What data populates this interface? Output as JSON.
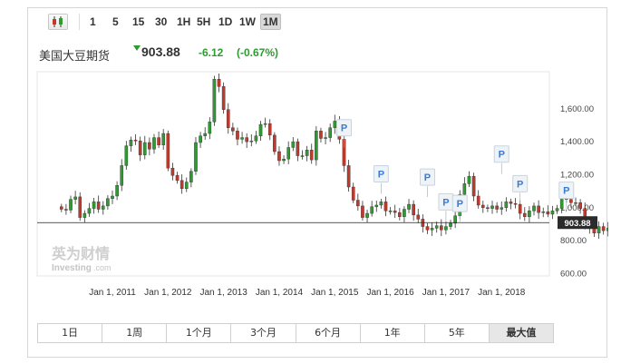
{
  "toolbar": {
    "chart_type_icon": "candlestick-icon",
    "timeframes": [
      "1",
      "5",
      "15",
      "30",
      "1H",
      "5H",
      "1D",
      "1W",
      "1M"
    ],
    "active_timeframe": "1M"
  },
  "header": {
    "instrument": "美国大豆期货",
    "direction_icon": "triangle-down-icon",
    "price": "903.88",
    "change": "-6.12",
    "change_pct": "(-0.67%)",
    "change_color": "#2f9a31"
  },
  "watermark": {
    "logo_text": "英为财情",
    "brand": "Investing",
    "domain": ".com"
  },
  "chart_data": {
    "type": "candlestick",
    "y_ticks": [
      "1,600.00",
      "1,400.00",
      "1,200.00",
      "1,000.00",
      "800.00",
      "600.00"
    ],
    "x_ticks": [
      "Jan 1, 2011",
      "Jan 1, 2012",
      "Jan 1, 2013",
      "Jan 1, 2014",
      "Jan 1, 2015",
      "Jan 1, 2016",
      "Jan 1, 2017",
      "Jan 1, 2018"
    ],
    "ylim": [
      580,
      1820
    ],
    "current_price_label": "903.88",
    "current_price": 903.88,
    "up_color": "#2f9a31",
    "down_color": "#c0392b",
    "monthly_close": [
      985,
      980,
      1045,
      1060,
      935,
      960,
      990,
      1030,
      985,
      1005,
      1050,
      1065,
      1130,
      1250,
      1370,
      1405,
      1400,
      1315,
      1390,
      1350,
      1420,
      1375,
      1445,
      1235,
      1190,
      1160,
      1110,
      1150,
      1215,
      1390,
      1430,
      1445,
      1515,
      1775,
      1730,
      1590,
      1480,
      1460,
      1410,
      1420,
      1395,
      1400,
      1430,
      1500,
      1505,
      1435,
      1335,
      1280,
      1290,
      1360,
      1395,
      1310,
      1310,
      1345,
      1285,
      1460,
      1415,
      1420,
      1480,
      1520,
      1410,
      1250,
      1120,
      1040,
      1005,
      935,
      960,
      1000,
      1010,
      1030,
      975,
      975,
      965,
      940,
      985,
      1015,
      950,
      925,
      880,
      860,
      870,
      885,
      860,
      880,
      900,
      945,
      1075,
      1140,
      1185,
      1065,
      1010,
      995,
      990,
      1005,
      985,
      995,
      1030,
      1020,
      1015,
      960,
      940,
      975,
      1005,
      965,
      970,
      955,
      975,
      990,
      1050,
      1045,
      1025,
      1025,
      990,
      885,
      870,
      840,
      880,
      855,
      870,
      903.88
    ],
    "markers": [
      {
        "label": "P",
        "month": 50,
        "price": 1480
      },
      {
        "label": "P",
        "month": 58,
        "price": 1200
      },
      {
        "label": "P",
        "month": 68,
        "price": 1180
      },
      {
        "label": "P",
        "month": 72,
        "price": 1030
      },
      {
        "label": "P",
        "month": 75,
        "price": 1020
      },
      {
        "label": "P",
        "month": 84,
        "price": 1320
      },
      {
        "label": "P",
        "month": 88,
        "price": 1140
      },
      {
        "label": "P",
        "month": 98,
        "price": 1100
      }
    ]
  },
  "ranges": [
    "1日",
    "1周",
    "1个月",
    "3个月",
    "6个月",
    "1年",
    "5年",
    "最大值"
  ],
  "active_range": "最大值"
}
